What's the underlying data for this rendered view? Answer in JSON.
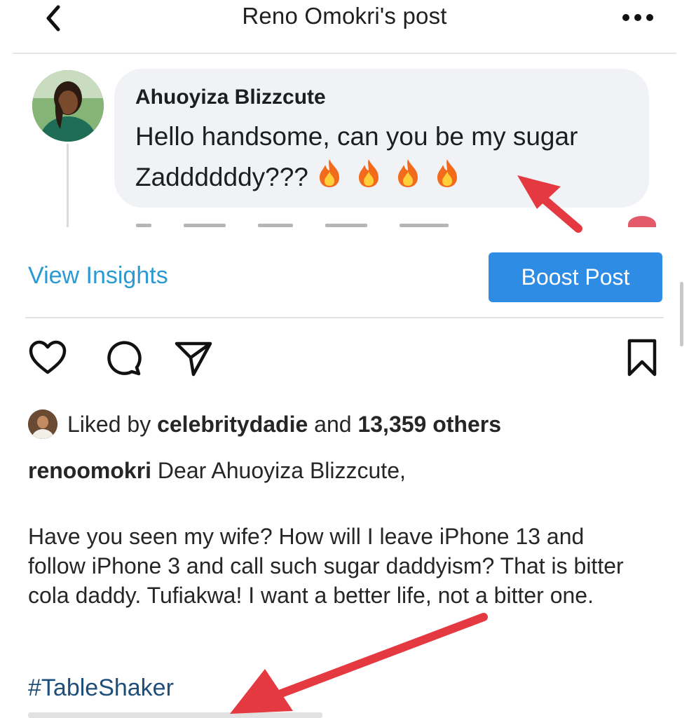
{
  "header": {
    "title": "Reno Omokri's post",
    "back_icon": "chevron-left-icon",
    "more_icon": "more-horizontal-icon"
  },
  "comment": {
    "author": "Ahuoyiza Blizzcute",
    "text": "Hello handsome, can you be my sugar Zaddddddy???",
    "emoji_count": 4,
    "emoji_icon": "fire-icon"
  },
  "insights": {
    "view_insights_label": "View Insights",
    "boost_label": "Boost Post"
  },
  "actions": {
    "like_icon": "heart-icon",
    "comment_icon": "comment-icon",
    "share_icon": "send-icon",
    "save_icon": "bookmark-icon"
  },
  "likes": {
    "prefix": "Liked by",
    "user": "celebritydadie",
    "middle": "and",
    "count_text": "13,359 others"
  },
  "caption": {
    "username": "renoomokri",
    "greeting": "Dear Ahuoyiza Blizzcute,",
    "body": "Have you seen my wife? How will I leave iPhone 13 and follow iPhone 3 and call such sugar daddyism? That is bitter cola daddy. Tufiakwa! I want a better life, not a bitter one.",
    "hashtag": "#TableShaker"
  },
  "colors": {
    "link_blue": "#2b9ad3",
    "boost_blue": "#2f8ce4",
    "hashtag_blue": "#1e4f7a",
    "annotation_red": "#e53941",
    "bubble_bg": "#f0f2f5"
  }
}
